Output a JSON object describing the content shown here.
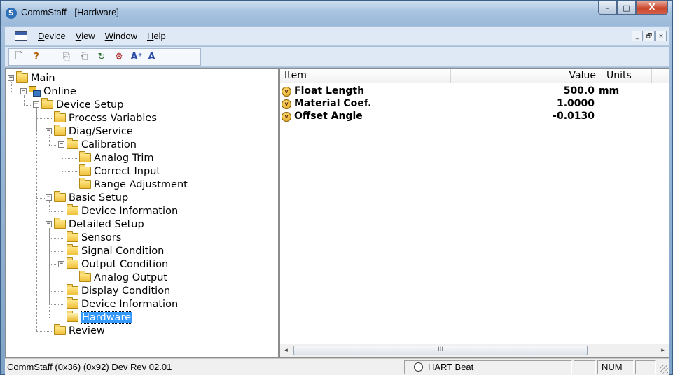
{
  "window": {
    "title": "CommStaff - [Hardware]",
    "app_icon": "commstaff-icon",
    "caption": {
      "minimize": "–",
      "maximize": "□",
      "close": "X"
    }
  },
  "menu": {
    "items": [
      "Device",
      "View",
      "Window",
      "Help"
    ],
    "mnemonics": [
      "D",
      "V",
      "W",
      "H"
    ],
    "rest": [
      "evice",
      "iew",
      "indow",
      "elp"
    ],
    "mdi": {
      "minimize": "_",
      "restore": "🗗",
      "close": "×"
    }
  },
  "toolbar": {
    "buttons": [
      {
        "name": "new-icon",
        "glyph": "🗋"
      },
      {
        "name": "help-icon",
        "glyph": "?"
      },
      {
        "name": "disconnect-icon",
        "glyph": "⎘"
      },
      {
        "name": "connect-icon",
        "glyph": "⎗"
      },
      {
        "name": "refresh-icon",
        "glyph": "↻"
      },
      {
        "name": "online-icon",
        "glyph": "⚙"
      },
      {
        "name": "font-increase-icon",
        "glyph": "A⁺"
      },
      {
        "name": "font-decrease-icon",
        "glyph": "A⁻"
      }
    ]
  },
  "tree": {
    "items": [
      {
        "label": "Main",
        "level": 0,
        "expander": "−",
        "icon": "folder-icon"
      },
      {
        "label": "Online",
        "level": 1,
        "expander": "−",
        "icon": "network-icon"
      },
      {
        "label": "Device Setup",
        "level": 2,
        "expander": "−",
        "icon": "folder-icon"
      },
      {
        "label": "Process Variables",
        "level": 3,
        "expander": "",
        "icon": "folder-icon"
      },
      {
        "label": "Diag/Service",
        "level": 3,
        "expander": "−",
        "icon": "folder-icon"
      },
      {
        "label": "Calibration",
        "level": 4,
        "expander": "−",
        "icon": "folder-icon"
      },
      {
        "label": "Analog Trim",
        "level": 5,
        "expander": "",
        "icon": "folder-icon"
      },
      {
        "label": "Correct Input",
        "level": 5,
        "expander": "",
        "icon": "folder-icon"
      },
      {
        "label": "Range Adjustment",
        "level": 5,
        "expander": "",
        "icon": "folder-icon"
      },
      {
        "label": "Basic Setup",
        "level": 3,
        "expander": "−",
        "icon": "folder-icon"
      },
      {
        "label": "Device Information",
        "level": 4,
        "expander": "",
        "icon": "folder-icon"
      },
      {
        "label": "Detailed Setup",
        "level": 3,
        "expander": "−",
        "icon": "folder-icon"
      },
      {
        "label": "Sensors",
        "level": 4,
        "expander": "",
        "icon": "folder-icon"
      },
      {
        "label": "Signal Condition",
        "level": 4,
        "expander": "",
        "icon": "folder-icon"
      },
      {
        "label": "Output Condition",
        "level": 4,
        "expander": "−",
        "icon": "folder-icon"
      },
      {
        "label": "Analog Output",
        "level": 5,
        "expander": "",
        "icon": "folder-icon"
      },
      {
        "label": "Display Condition",
        "level": 4,
        "expander": "",
        "icon": "folder-icon"
      },
      {
        "label": "Device Information",
        "level": 4,
        "expander": "",
        "icon": "folder-icon"
      },
      {
        "label": "Hardware",
        "level": 4,
        "expander": "",
        "icon": "folder-open-icon",
        "selected": true
      },
      {
        "label": "Review",
        "level": 3,
        "expander": "",
        "icon": "folder-icon"
      }
    ]
  },
  "list": {
    "headers": {
      "item": "Item",
      "value": "Value",
      "units": "Units"
    },
    "rows": [
      {
        "label": "Float Length",
        "value": "500.0",
        "unit": "mm",
        "icon": "variable-icon"
      },
      {
        "label": "Material Coef.",
        "value": "1.0000",
        "unit": "",
        "icon": "variable-icon"
      },
      {
        "label": "Offset Angle",
        "value": "-0.0130",
        "unit": "",
        "icon": "variable-icon"
      }
    ],
    "scrollbar": {
      "left": "◂",
      "right": "▸",
      "thumb": "III"
    }
  },
  "status": {
    "left": "CommStaff  (0x36)  (0x92) Dev Rev 02.01",
    "heartbeat": "HART Beat",
    "num": "NUM"
  }
}
